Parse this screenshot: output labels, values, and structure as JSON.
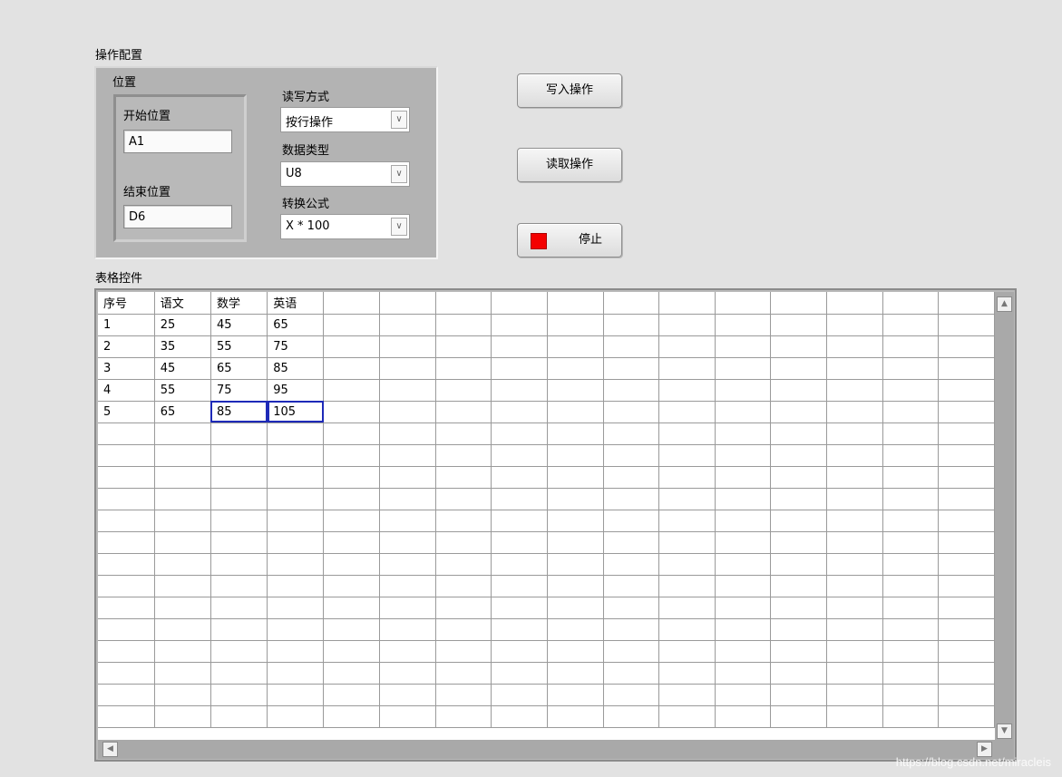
{
  "config": {
    "title": "操作配置",
    "position_group": {
      "title": "位置",
      "start_label": "开始位置",
      "start_value": "A1",
      "end_label": "结束位置",
      "end_value": "D6"
    },
    "rw_mode": {
      "label": "读写方式",
      "value": "按行操作"
    },
    "data_type": {
      "label": "数据类型",
      "value": "U8"
    },
    "formula": {
      "label": "转换公式",
      "value": "X * 100"
    }
  },
  "buttons": {
    "write_label": "写入操作",
    "read_label": "读取操作",
    "stop_label": "停止",
    "stop_led_color": "#f40000"
  },
  "table": {
    "label": "表格控件",
    "rows": [
      [
        "序号",
        "语文",
        "数学",
        "英语"
      ],
      [
        "1",
        "25",
        "45",
        "65"
      ],
      [
        "2",
        "35",
        "55",
        "75"
      ],
      [
        "3",
        "45",
        "65",
        "85"
      ],
      [
        "4",
        "55",
        "75",
        "95"
      ],
      [
        "5",
        "65",
        "85",
        "105"
      ]
    ],
    "selected_cells": [
      [
        5,
        2
      ],
      [
        5,
        3
      ]
    ],
    "selection_color": "#1e2ab8"
  },
  "watermark": "https://blog.csdn.net/miracleis"
}
